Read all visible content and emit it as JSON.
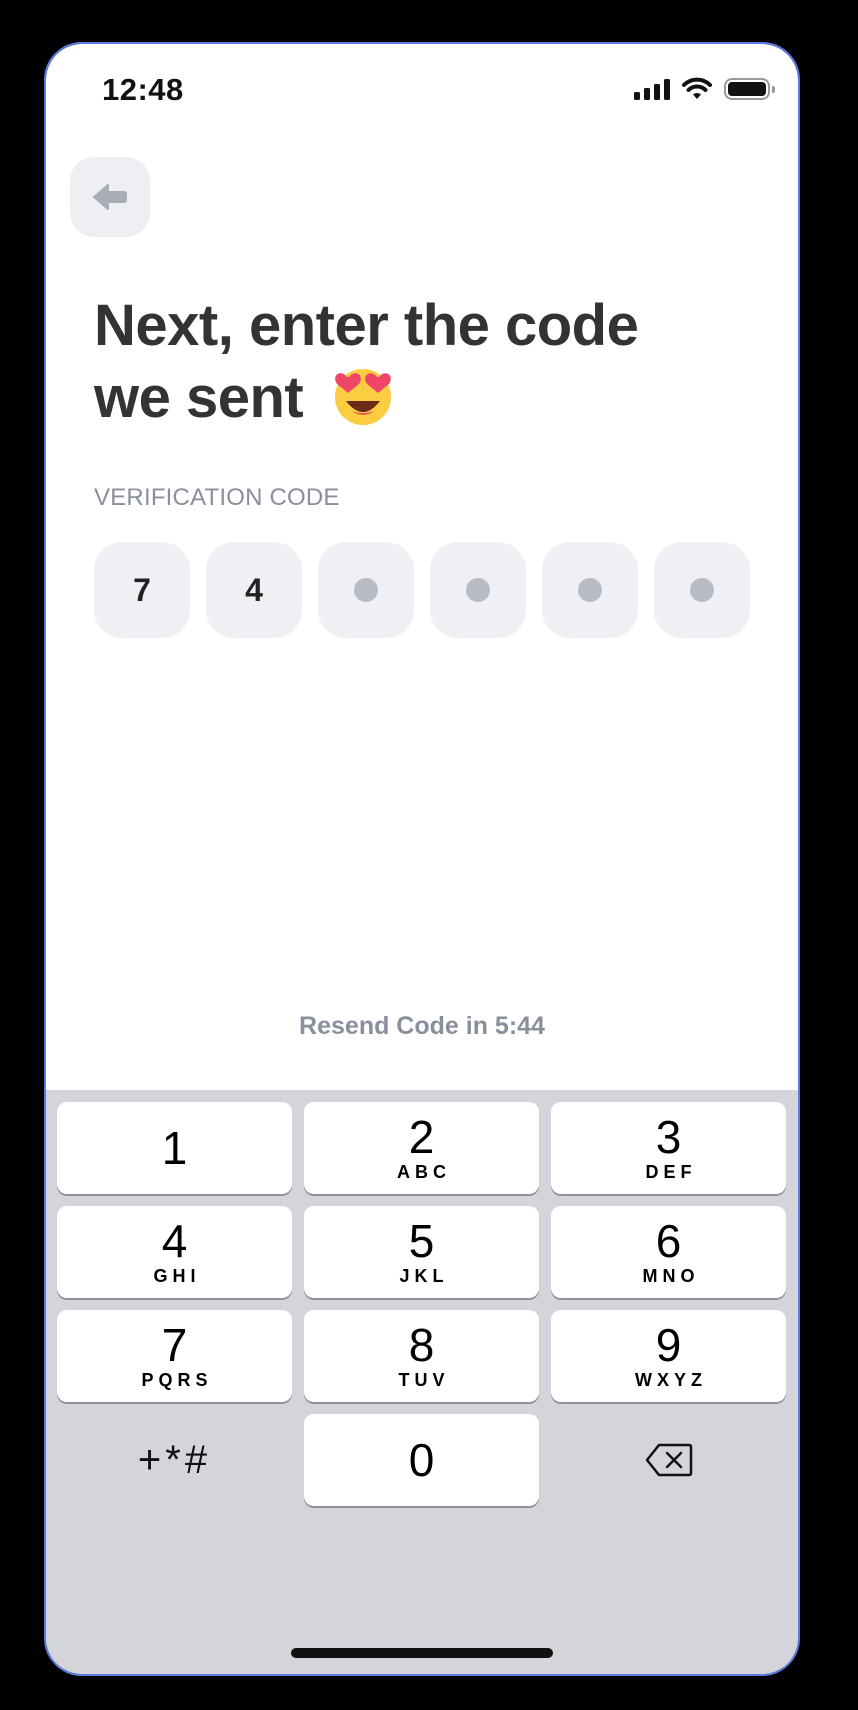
{
  "status_bar": {
    "time": "12:48",
    "icons": [
      "cellular-signal-icon",
      "wifi-icon",
      "battery-icon"
    ]
  },
  "header": {
    "back_icon": "arrow-left-icon"
  },
  "headline": {
    "line1": "Next, enter the code",
    "line2": "we sent",
    "emoji": "smiling-face-with-heart-eyes"
  },
  "verification": {
    "label": "VERIFICATION CODE",
    "digits": [
      "7",
      "4",
      "",
      "",
      "",
      ""
    ],
    "empty_indicator": "dot"
  },
  "resend": {
    "text": "Resend Code in 5:44"
  },
  "keypad": {
    "keys": [
      {
        "num": "1",
        "letters": ""
      },
      {
        "num": "2",
        "letters": "ABC"
      },
      {
        "num": "3",
        "letters": "DEF"
      },
      {
        "num": "4",
        "letters": "GHI"
      },
      {
        "num": "5",
        "letters": "JKL"
      },
      {
        "num": "6",
        "letters": "MNO"
      },
      {
        "num": "7",
        "letters": "PQRS"
      },
      {
        "num": "8",
        "letters": "TUV"
      },
      {
        "num": "9",
        "letters": "WXYZ"
      },
      {
        "num": "0",
        "letters": ""
      }
    ],
    "symbols": "+*#",
    "delete_icon": "backspace-icon"
  },
  "colors": {
    "headline": "#333333",
    "muted": "#8a8f9c",
    "code_box": "#eff0f4",
    "keyboard_bg": "#d3d5db",
    "frame_outline": "#5b7be0"
  }
}
